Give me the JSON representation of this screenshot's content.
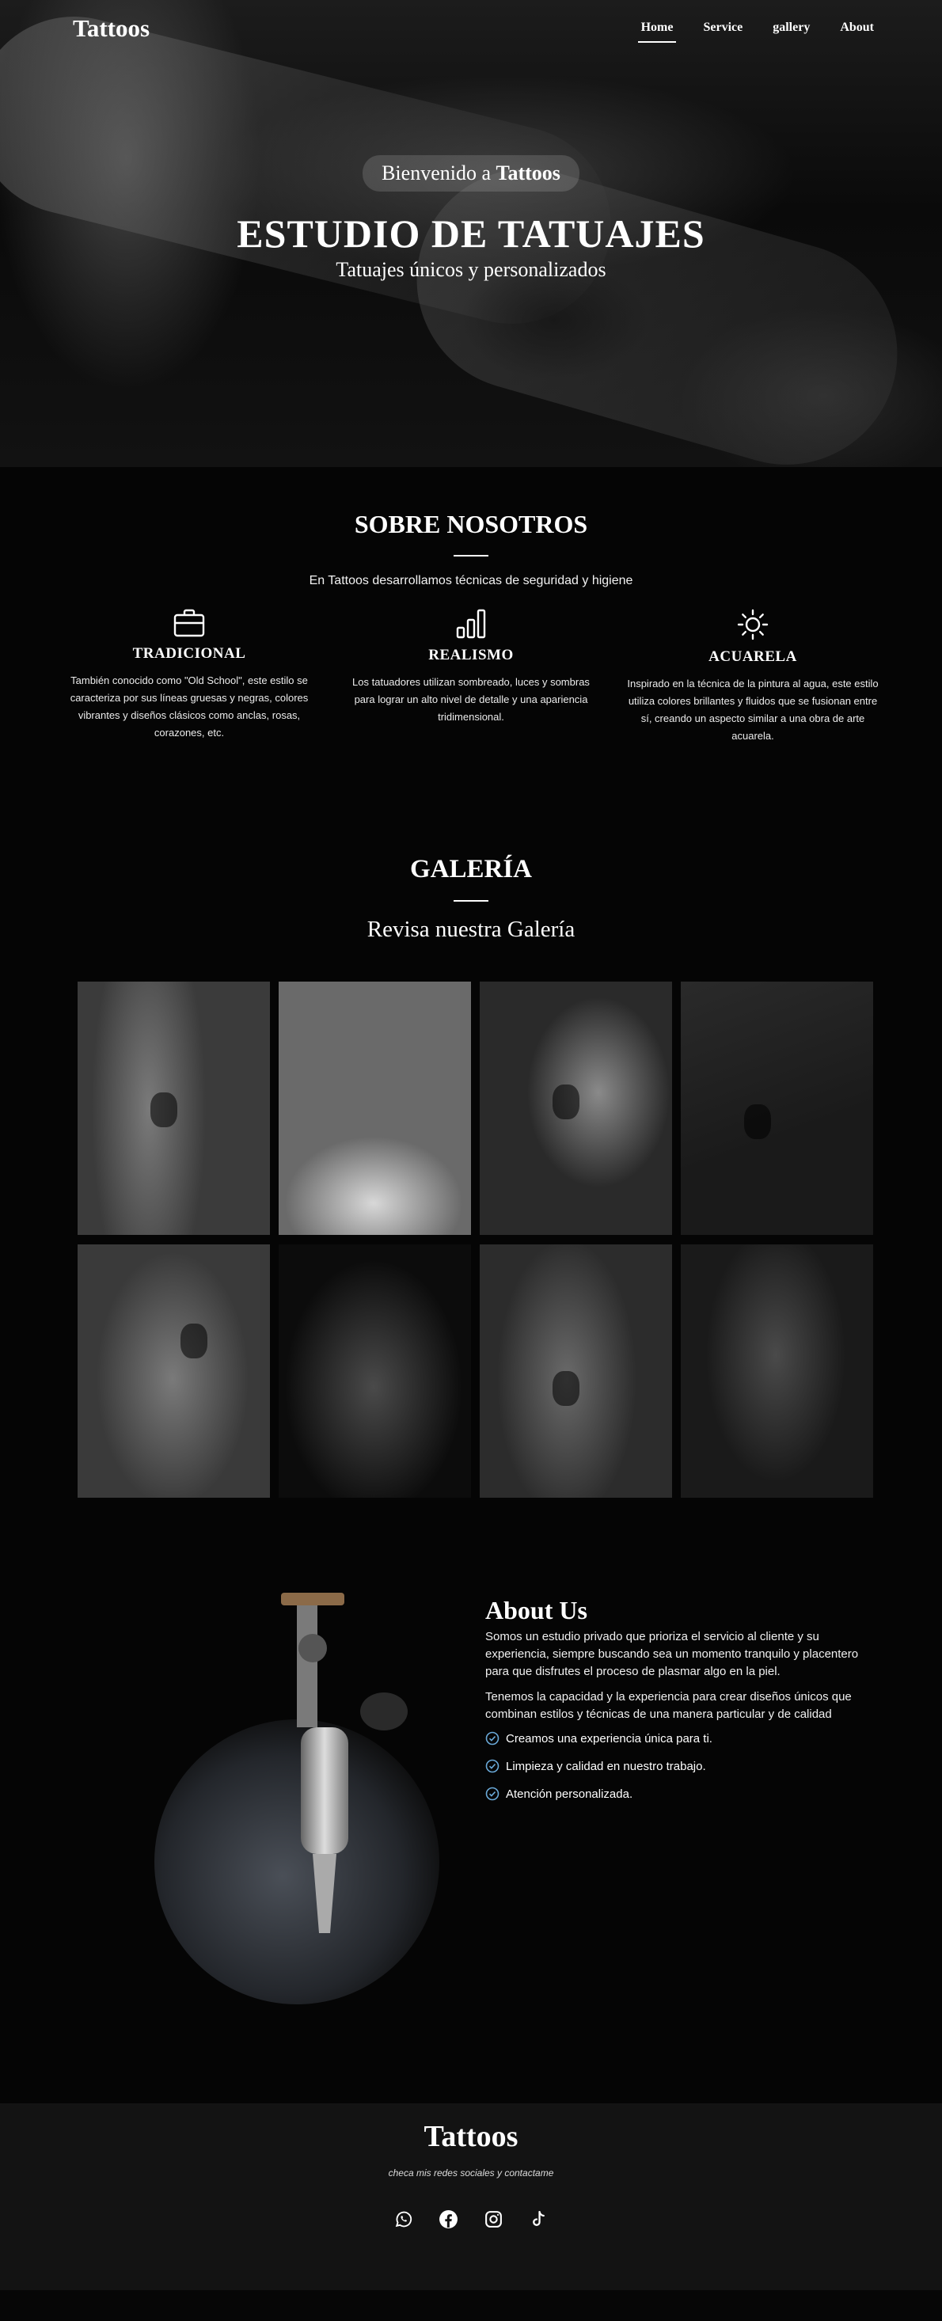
{
  "nav": {
    "brand": "Tattoos",
    "links": [
      {
        "label": "Home",
        "active": true
      },
      {
        "label": "Service",
        "active": false
      },
      {
        "label": "gallery",
        "active": false
      },
      {
        "label": "About",
        "active": false
      }
    ]
  },
  "hero": {
    "welcome_prefix": "Bienvenido a",
    "welcome_brand": "Tattoos",
    "title": "ESTUDIO DE TATUAJES",
    "subtitle": "Tatuajes únicos y personalizados"
  },
  "about_section": {
    "title": "SOBRE NOSOTROS",
    "intro": "En Tattoos desarrollamos técnicas de seguridad y higiene",
    "features": [
      {
        "icon": "briefcase-icon",
        "title": "TRADICIONAL",
        "text": "También conocido como \"Old School\", este estilo se caracteriza por sus líneas gruesas y negras, colores vibrantes y diseños clásicos como anclas, rosas, corazones, etc."
      },
      {
        "icon": "bar-chart-icon",
        "title": "REALISMO",
        "text": "Los tatuadores utilizan sombreado, luces y sombras para lograr un alto nivel de detalle y una apariencia tridimensional."
      },
      {
        "icon": "sun-icon",
        "title": "ACUARELA",
        "text": "Inspirado en la técnica de la pintura al agua, este estilo utiliza colores brillantes y fluidos que se fusionan entre sí, creando un aspecto similar a una obra de arte acuarela."
      }
    ]
  },
  "gallery": {
    "title": "GALERÍA",
    "subtitle": "Revisa nuestra Galería",
    "images": [
      {
        "icon": "rose-tattoo-photo"
      },
      {
        "icon": "neck-tattoo-photo"
      },
      {
        "icon": "hand-tattoo-photo"
      },
      {
        "icon": "ankle-tattoo-photo"
      },
      {
        "icon": "leg-flower-tattoo-photo"
      },
      {
        "icon": "wrist-tattoos-photo"
      },
      {
        "icon": "rosary-tattoo-photo"
      },
      {
        "icon": "torso-tattoo-photo"
      }
    ]
  },
  "about_us": {
    "title": "About Us",
    "paragraph_1": "Somos un estudio privado que prioriza el servicio al cliente y su experiencia, siempre buscando sea un momento tranquilo y placentero para que disfrutes el proceso de plasmar algo en la piel.",
    "paragraph_2": "Tenemos la capacidad y la experiencia para crear diseños únicos que combinan estilos y técnicas de una manera particular y de calidad",
    "checklist": [
      "Creamos una experiencia única para ti.",
      "Limpieza y calidad en nuestro trabajo.",
      "Atención personalizada."
    ]
  },
  "footer": {
    "brand": "Tattoos",
    "tagline": "checa mis redes sociales y contactame",
    "socials": [
      {
        "icon": "whatsapp-icon"
      },
      {
        "icon": "facebook-icon"
      },
      {
        "icon": "instagram-icon"
      },
      {
        "icon": "tiktok-icon"
      }
    ]
  },
  "colors": {
    "background": "#060606",
    "footer": "#131313",
    "accent": "#6aa9d8",
    "text": "#ffffff"
  }
}
